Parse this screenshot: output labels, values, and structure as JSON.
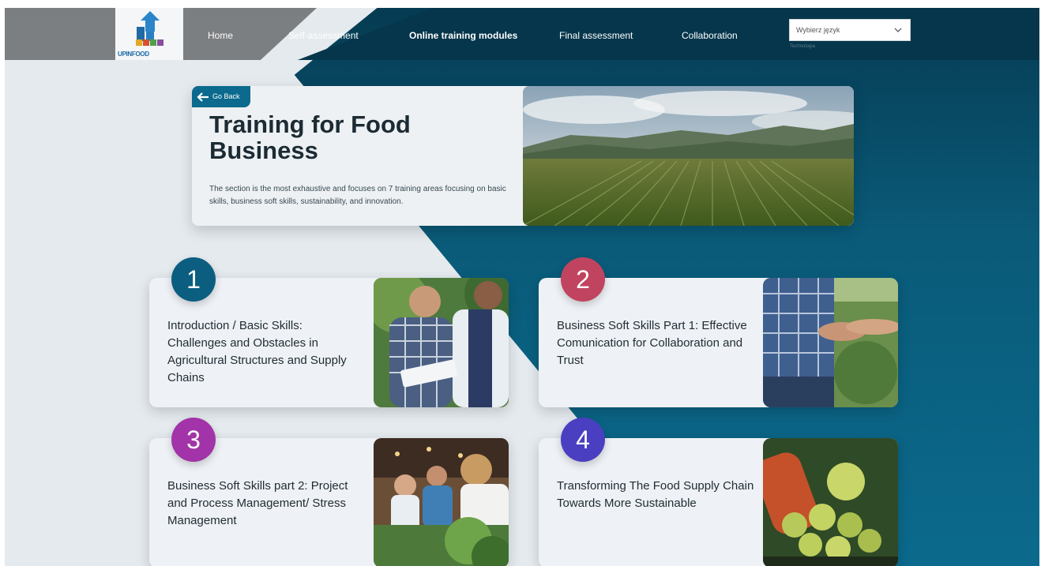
{
  "header": {
    "logo_text": "UPINFOOD",
    "nav": [
      "Home",
      "Self-assessment",
      "Online training modules",
      "Final assessment",
      "Collaboration"
    ],
    "language_select": {
      "value": "Wybierz język",
      "caption": "Technologia"
    }
  },
  "hero": {
    "back_label": "Go Back",
    "title": "Training for Food Business",
    "description": "The section is the most exhaustive and focuses on 7 training areas focusing on basic skills, business soft skills, sustainability, and innovation."
  },
  "modules": [
    {
      "number": "1",
      "title": "Introduction / Basic Skills: Challenges and Obstacles in Agricultural Structures and Supply Chains",
      "color": "#0b5e80"
    },
    {
      "number": "2",
      "title": "Business Soft Skills Part 1: Effective Comunication for Collaboration and Trust",
      "color": "#c0445f"
    },
    {
      "number": "3",
      "title": "Business Soft Skills part 2: Project and Process Management/ Stress Management",
      "color": "#a233a8"
    },
    {
      "number": "4",
      "title": "Transforming The Food Supply Chain Towards More Sustainable",
      "color": "#4a3fc0"
    }
  ]
}
